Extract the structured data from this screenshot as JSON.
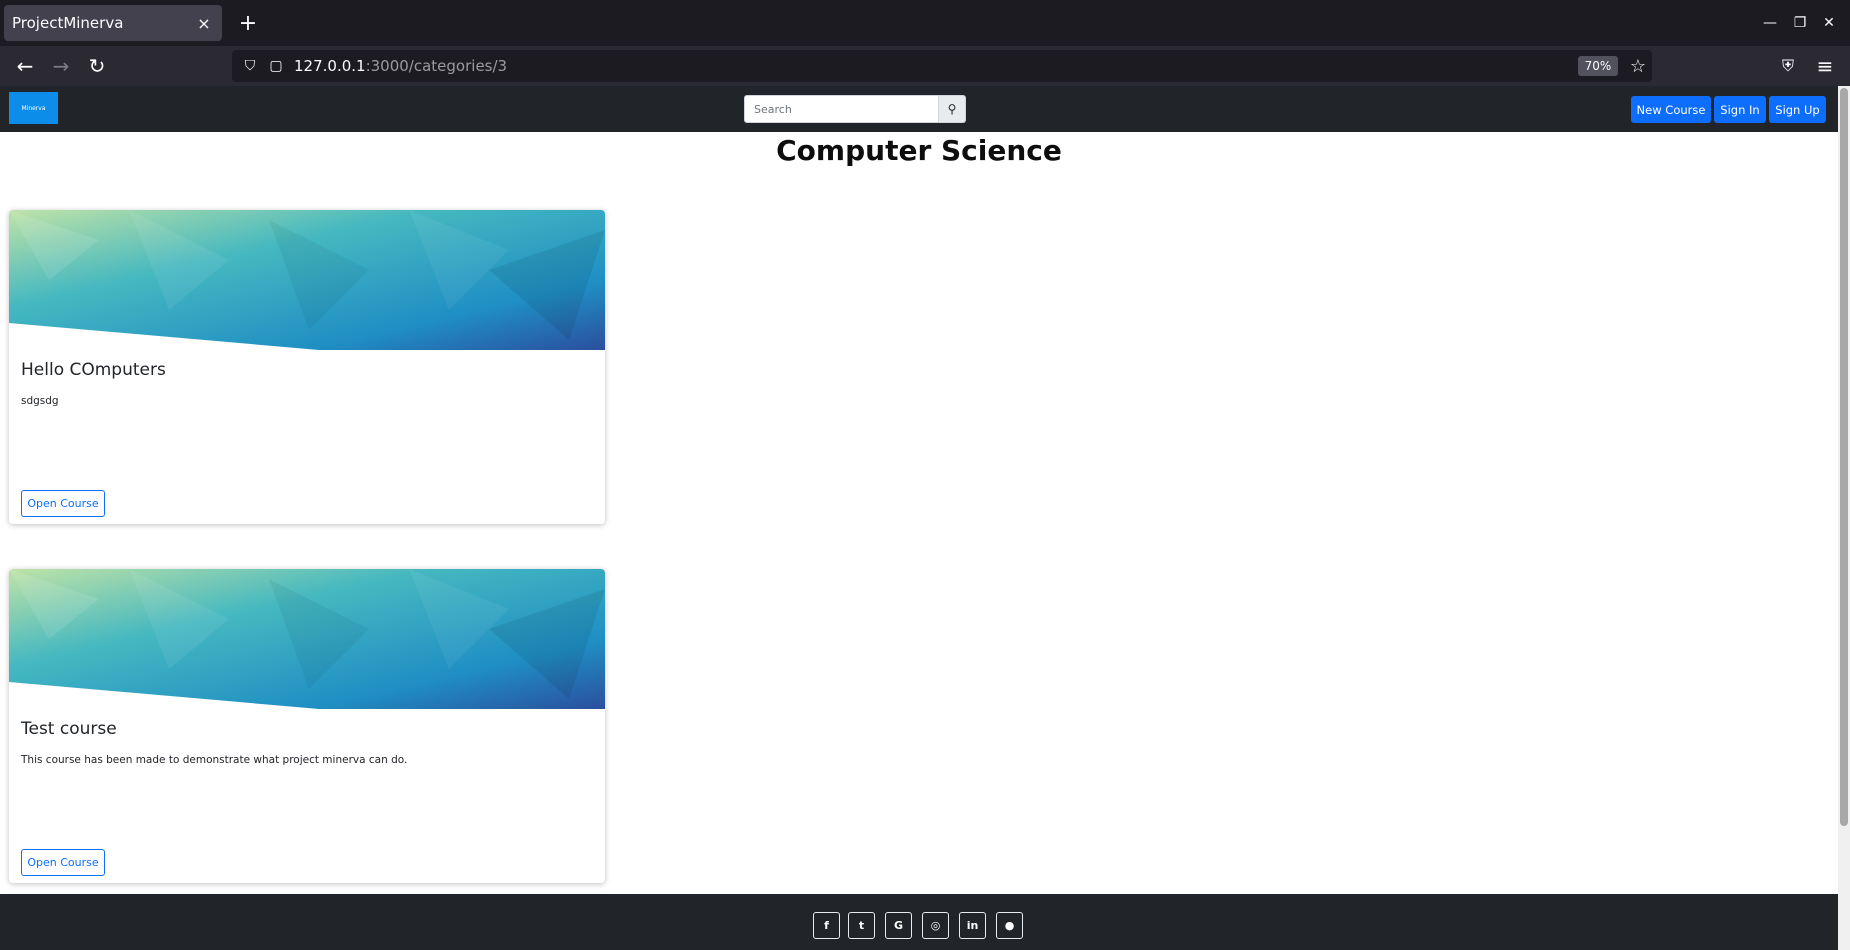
{
  "browser": {
    "tab_title": "ProjectMinerva",
    "tab_close_icon": "×",
    "new_tab_icon": "+",
    "url_host": "127.0.0.1",
    "url_rest": ":3000/categories/3",
    "zoom": "70%",
    "window_controls": {
      "minimize": "—",
      "restore": "❐",
      "close": "✕"
    },
    "nav_icons": {
      "back": "←",
      "forward": "→",
      "reload": "↻",
      "shield": "⛉",
      "page": "▢",
      "star": "☆",
      "pocket": "⛨",
      "menu": "≡"
    }
  },
  "site": {
    "logo_text": "Minerva",
    "search": {
      "placeholder": "Search",
      "button_icon": "⚲"
    },
    "buttons": {
      "new_course": "New Course",
      "sign_in": "Sign In",
      "sign_up": "Sign Up"
    },
    "page_title": "Computer Science",
    "courses": [
      {
        "title": "Hello COmputers",
        "description": "sdgsdg",
        "button": "Open Course"
      },
      {
        "title": "Test course",
        "description": "This course has been made to demonstrate what project minerva can do.",
        "button": "Open Course"
      }
    ],
    "footer_social": [
      {
        "name": "facebook",
        "glyph": "f"
      },
      {
        "name": "twitter",
        "glyph": "t"
      },
      {
        "name": "google",
        "glyph": "G"
      },
      {
        "name": "instagram",
        "glyph": "◎"
      },
      {
        "name": "linkedin",
        "glyph": "in"
      },
      {
        "name": "github",
        "glyph": "●"
      }
    ]
  }
}
